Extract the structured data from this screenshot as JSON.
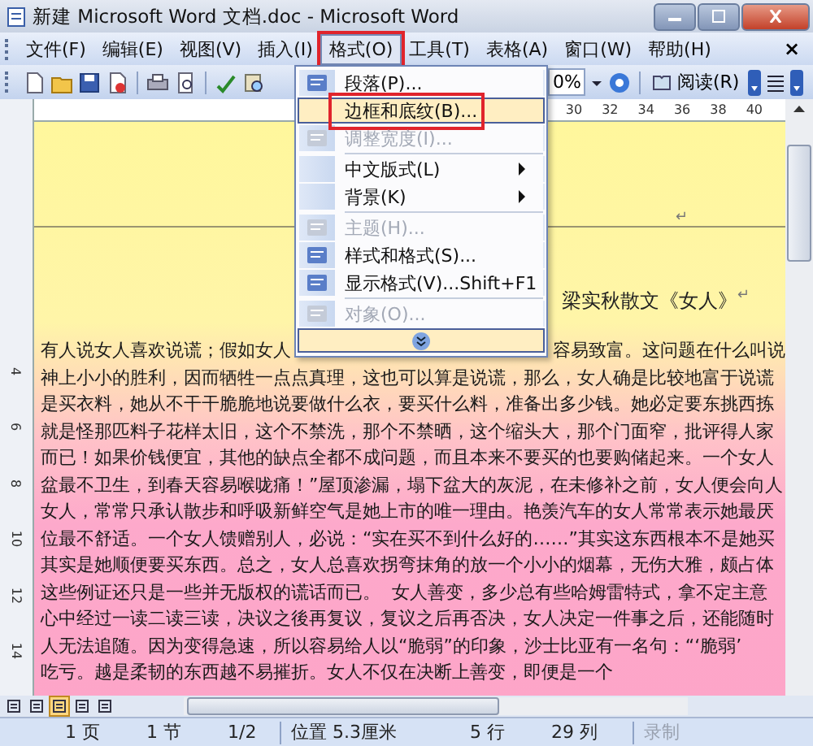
{
  "window": {
    "title": "新建 Microsoft Word 文档.doc - Microsoft Word"
  },
  "menu_bar": [
    {
      "label": "文件(F)",
      "selected": false
    },
    {
      "label": "编辑(E)",
      "selected": false
    },
    {
      "label": "视图(V)",
      "selected": false
    },
    {
      "label": "插入(I)",
      "selected": false
    },
    {
      "label": "格式(O)",
      "selected": true,
      "annotated": true
    },
    {
      "label": "工具(T)",
      "selected": false
    },
    {
      "label": "表格(A)",
      "selected": false
    },
    {
      "label": "窗口(W)",
      "selected": false
    },
    {
      "label": "帮助(H)",
      "selected": false
    }
  ],
  "menu_close": "×",
  "toolbar": {
    "zoom": "0%",
    "read_button": "阅读(R)"
  },
  "ruler": {
    "ticks": [
      "30",
      "32",
      "34",
      "36",
      "38",
      "40"
    ],
    "vertical_ticks": [
      "4",
      "6",
      "8",
      "10",
      "12",
      "14"
    ]
  },
  "format_menu": {
    "items": [
      {
        "kind": "item",
        "label": "段落(P)...",
        "icon": true,
        "disabled": false,
        "selected": false,
        "submenu": false,
        "separator_before": false
      },
      {
        "kind": "item",
        "label": "边框和底纹(B)...",
        "icon": false,
        "disabled": false,
        "selected": true,
        "annotated": true,
        "submenu": false,
        "separator_before": false
      },
      {
        "kind": "item",
        "label": "调整宽度(I)...",
        "icon": true,
        "disabled": true,
        "selected": false,
        "submenu": false,
        "separator_before": false
      },
      {
        "kind": "item",
        "label": "中文版式(L)",
        "icon": false,
        "disabled": false,
        "selected": false,
        "submenu": true,
        "separator_before": true
      },
      {
        "kind": "item",
        "label": "背景(K)",
        "icon": false,
        "disabled": false,
        "selected": false,
        "submenu": true,
        "separator_before": false
      },
      {
        "kind": "item",
        "label": "主题(H)...",
        "icon": true,
        "disabled": true,
        "selected": false,
        "submenu": false,
        "separator_before": true
      },
      {
        "kind": "item",
        "label": "样式和格式(S)...",
        "icon": true,
        "disabled": false,
        "selected": false,
        "submenu": false,
        "separator_before": false
      },
      {
        "kind": "item",
        "label": "显示格式(V)...",
        "shortcut": "Shift+F1",
        "icon": true,
        "disabled": false,
        "selected": false,
        "submenu": false,
        "separator_before": false
      },
      {
        "kind": "item",
        "label": "对象(O)...",
        "icon": true,
        "disabled": true,
        "selected": false,
        "submenu": false,
        "separator_before": true
      },
      {
        "kind": "expand",
        "selected": true
      }
    ]
  },
  "document": {
    "header_mark": "↵",
    "title": "梁实秋散文《女人》",
    "title_mark": "↵",
    "lines": [
      {
        "text": "有人说女人喜欢说谎；假如女人",
        "text_right": "容易致富。这问题在什么叫说"
      },
      {
        "text": "神上小小的胜利，因而牺牲一点点真理，这也可以算是说谎，那么，女人确是比较地富于说谎"
      },
      {
        "text": "是买衣料，她从不干干脆脆地说要做什么衣，要买什么料，准备出多少钱。她必定要东挑西拣"
      },
      {
        "text": "就是怪那匹料子花样太旧，这个不禁洗，那个不禁晒，这个缩头大，那个门面窄，批评得人家"
      },
      {
        "text": "而已！如果价钱便宜，其他的缺点全都不成问题，而且本来不要买的也要购储起来。一个女人"
      },
      {
        "text": "盆最不卫生，到春天容易喉咙痛！”屋顶渗漏，塌下盆大的灰泥，在未修补之前，女人便会向人"
      },
      {
        "text": "女人，常常只承认散步和呼吸新鲜空气是她上市的唯一理由。艳羡汽车的女人常常表示她最厌"
      },
      {
        "text": "位最不舒适。一个女人馈赠别人，必说：“实在买不到什么好的……”其实这东西根本不是她买"
      },
      {
        "text": "其实是她顺便要买东西。总之，女人总喜欢拐弯抹角的放一个小小的烟幕，无伤大雅，颇占体"
      },
      {
        "text": "这些例证还只是一些并无版权的谎话而已。  女人善变，多少总有些哈姆雷特式，拿不定主意"
      },
      {
        "text": "心中经过一读二读三读，决议之後再复议，复议之后再否决，女人决定一件事之后，还能随时"
      },
      {
        "text": "人无法追随。因为变得急速，所以容易给人以“脆弱”的印象，沙士比亚有一名句：“‘脆弱’"
      },
      {
        "text": "吃亏。越是柔韧的东西越不易摧折。女人不仅在决断上善变，即便是一个"
      }
    ]
  },
  "view_buttons": [
    {
      "selected": false
    },
    {
      "selected": false
    },
    {
      "selected": true
    },
    {
      "selected": false
    },
    {
      "selected": false
    }
  ],
  "status_bar": {
    "page": "1 页",
    "section": "1 节",
    "pages": "1/2",
    "position": "位置 5.3厘米",
    "line": "5 行",
    "column": "29 列",
    "record": "录制",
    "record_disabled": true
  }
}
